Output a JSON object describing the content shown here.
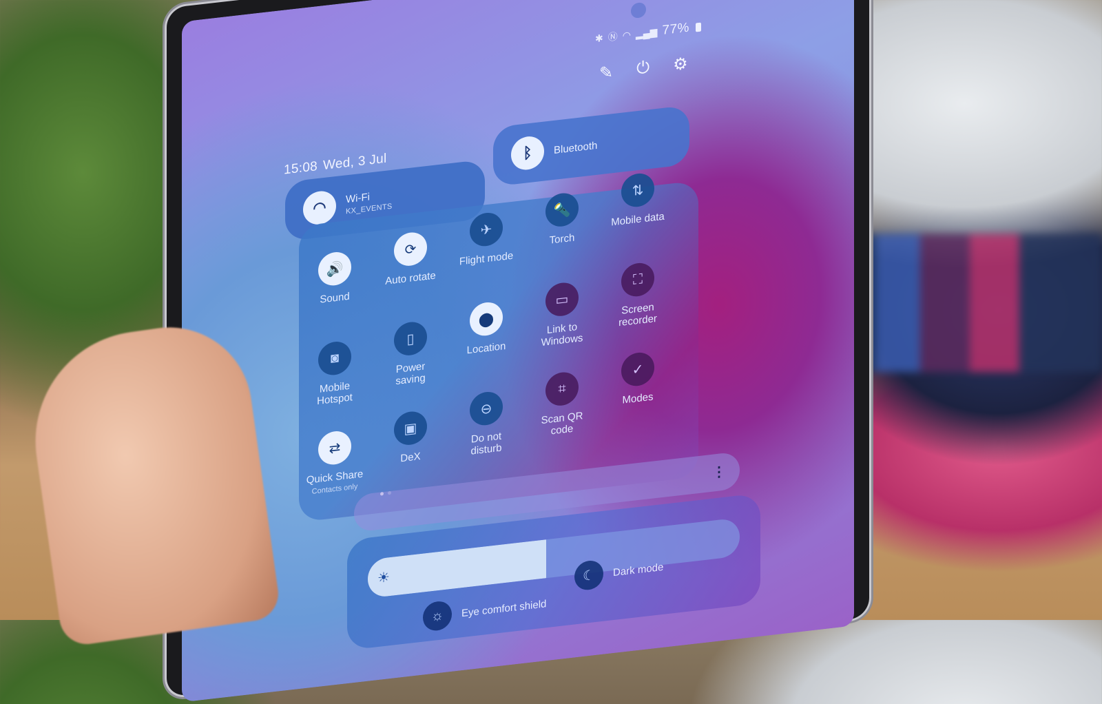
{
  "status_bar": {
    "icons": [
      "bluetooth-icon",
      "nfc-icon",
      "wifi-icon",
      "signal-icon"
    ],
    "battery_percent": "77%"
  },
  "top_actions": [
    {
      "name": "edit",
      "glyph": "✎"
    },
    {
      "name": "power",
      "glyph": "⏻"
    },
    {
      "name": "settings",
      "glyph": "⚙"
    }
  ],
  "clock": {
    "time": "15:08",
    "date": "Wed, 3 Jul"
  },
  "wifi": {
    "label": "Wi-Fi",
    "network": "KX_EVENTS",
    "glyph": "◠"
  },
  "bluetooth": {
    "label": "Bluetooth",
    "glyph": "ᛒ"
  },
  "quick_settings": [
    {
      "id": "sound",
      "label": "Sound",
      "glyph": "🔊",
      "on": true
    },
    {
      "id": "auto-rotate",
      "label": "Auto rotate",
      "glyph": "⟳",
      "on": true
    },
    {
      "id": "flight-mode",
      "label": "Flight mode",
      "glyph": "✈",
      "on": false
    },
    {
      "id": "torch",
      "label": "Torch",
      "glyph": "🔦",
      "on": false
    },
    {
      "id": "mobile-data",
      "label": "Mobile data",
      "glyph": "⇅",
      "on": false
    },
    {
      "id": "mobile-hotspot",
      "label": "Mobile Hotspot",
      "glyph": "◙",
      "on": false
    },
    {
      "id": "power-saving",
      "label": "Power saving",
      "glyph": "▯",
      "on": false
    },
    {
      "id": "location",
      "label": "Location",
      "glyph": "⬤",
      "on": true
    },
    {
      "id": "link-to-windows",
      "label": "Link to Windows",
      "glyph": "▭",
      "on": false
    },
    {
      "id": "screen-recorder",
      "label": "Screen recorder",
      "glyph": "⛶",
      "on": false
    },
    {
      "id": "quick-share",
      "label": "Quick Share",
      "sub": "Contacts only",
      "glyph": "⇄",
      "on": true
    },
    {
      "id": "dex",
      "label": "DeX",
      "glyph": "▣",
      "on": false
    },
    {
      "id": "do-not-disturb",
      "label": "Do not disturb",
      "glyph": "⊖",
      "on": false
    },
    {
      "id": "scan-qr",
      "label": "Scan QR code",
      "glyph": "⌗",
      "on": false
    },
    {
      "id": "modes",
      "label": "Modes",
      "glyph": "✓",
      "on": false
    }
  ],
  "page_indicator": {
    "current": 1,
    "total": 2
  },
  "media": {
    "more_glyph": "⋮"
  },
  "brightness": {
    "level_percent": 48,
    "glyph": "☀"
  },
  "toggles": [
    {
      "id": "eye-comfort",
      "label": "Eye comfort shield",
      "glyph": "☼"
    },
    {
      "id": "dark-mode",
      "label": "Dark mode",
      "glyph": "☾"
    }
  ]
}
